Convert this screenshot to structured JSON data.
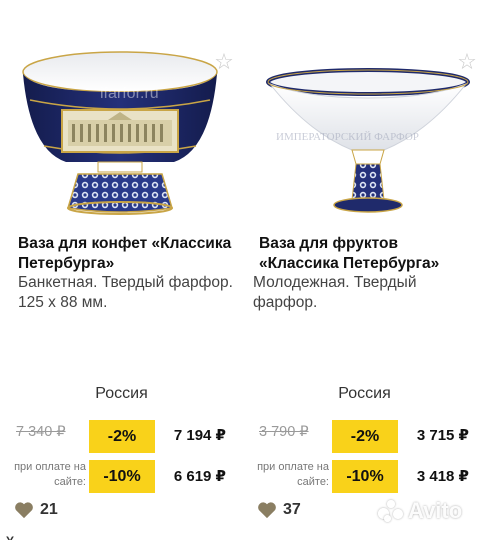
{
  "products": [
    {
      "title": "Ваза для конфет «Классика Петербурга»",
      "description": "Банкетная. Твердый фарфор. 125 х 88 мм.",
      "photo_watermark": "ifarfor.ru",
      "country": "Россия",
      "old_price": "7 340 ₽",
      "discount_1": "-2%",
      "price_1": "7 194 ₽",
      "pay_note": "при оплате на сайте:",
      "discount_2": "-10%",
      "price_2": "6 619 ₽",
      "likes": "21",
      "more_char": "Y"
    },
    {
      "title": "Ваза для фруктов «Классика Петербурга»",
      "description": "Молодежная. Твердый фарфор.",
      "photo_watermark": "ИМПЕРАТОРСКИЙ ФАРФОР",
      "country": "Россия",
      "old_price": "3 790 ₽",
      "discount_1": "-2%",
      "price_1": "3 715 ₽",
      "pay_note": "при оплате на сайте:",
      "discount_2": "-10%",
      "price_2": "3 418 ₽",
      "likes": "37"
    }
  ],
  "watermark": "Avito",
  "icons": {
    "favorite": "star-outline-icon",
    "like": "heart-icon"
  },
  "colors": {
    "discount_badge": "#f9d21a",
    "cobalt": "#1f2a6b",
    "gold": "#c9a546"
  }
}
